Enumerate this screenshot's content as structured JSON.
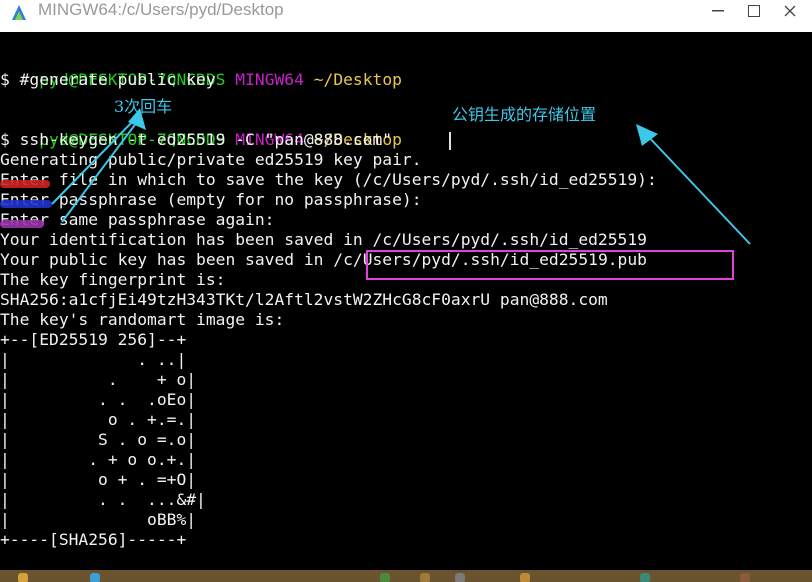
{
  "window": {
    "title": "MINGW64:/c/Users/pyd/Desktop",
    "controls": {
      "minimize_icon": "minimize-icon",
      "maximize_icon": "maximize-icon",
      "close_icon": "close-icon"
    }
  },
  "terminal": {
    "prompt1": {
      "user": "pyd@DESKTOP-7QNCDDS",
      "host": "MINGW64",
      "path": "~/Desktop"
    },
    "cmd1": "$ #generate public key",
    "prompt2": {
      "user": "pyd@DESKTOP-7QNCDDS",
      "host": "MINGW64",
      "path": "~/Desktop"
    },
    "cmd2": "$ ssh-keygen -t ed25519 -C \"pan@888.com\"",
    "out_generating": "Generating public/private ed25519 key pair.",
    "out_enter_file": "Enter file in which to save the key (/c/Users/pyd/.ssh/id_ed25519):",
    "out_enter_pass": "Enter passphrase (empty for no passphrase):",
    "out_enter_same": "Enter same passphrase again:",
    "out_identification": "Your identification has been saved in /c/Users/pyd/.ssh/id_ed25519",
    "out_public_prefix": "Your public key has been saved in ",
    "out_public_path": "/c/Users/pyd/.ssh/id_ed25519.pub",
    "out_fingerprint_label": "The key fingerprint is:",
    "out_fingerprint": "SHA256:a1cfjEi49tzH343TKt/l2Aftl2vstW2ZHcG8cF0axrU pan@888.com",
    "out_randomart_label": "The key's randomart image is:",
    "randomart": [
      "+--[ED25519 256]--+",
      "|             . ..|",
      "|          .    + o|",
      "|         . .  .oEo|",
      "|          o . +.=.|",
      "|         S . o =.o|",
      "|        . + o o.+.|",
      "|         o + . =+O|",
      "|         . .  ...&#|",
      "|              oBB%|",
      "+----[SHA256]-----+"
    ]
  },
  "annotations": {
    "three_enter": "3次回车",
    "pubkey_location": "公钥生成的存储位置"
  },
  "colors": {
    "background": "#000000",
    "prompt_user": "#1fd21f",
    "prompt_host": "#c820c8",
    "prompt_path": "#e8c84a",
    "annotation": "#3cc8e8",
    "highlight_box": "#e040e0",
    "underline_red": "#cc2222",
    "underline_blue": "#2233cc",
    "underline_purple": "#9933aa"
  }
}
